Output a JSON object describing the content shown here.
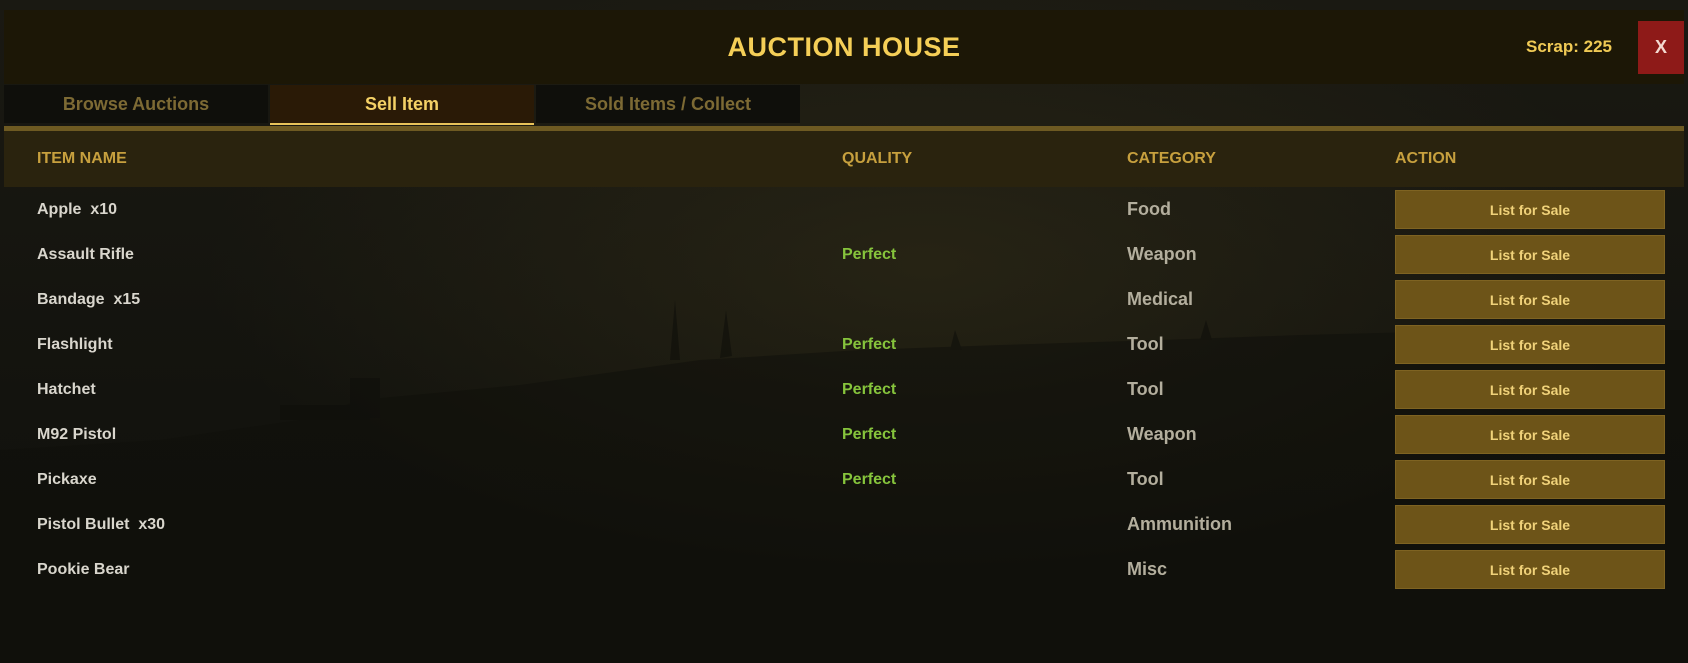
{
  "header": {
    "title": "AUCTION HOUSE",
    "scrap_label": "Scrap: 225",
    "close_label": "X"
  },
  "tabs": [
    {
      "label": "Browse Auctions",
      "active": false
    },
    {
      "label": "Sell Item",
      "active": true
    },
    {
      "label": "Sold Items / Collect",
      "active": false
    }
  ],
  "table": {
    "columns": [
      "ITEM NAME",
      "QUALITY",
      "CATEGORY",
      "ACTION"
    ],
    "rows": [
      {
        "name": "Apple  x10",
        "quality": "",
        "category": "Food",
        "action": "List for Sale"
      },
      {
        "name": "Assault Rifle",
        "quality": "Perfect",
        "category": "Weapon",
        "action": "List for Sale"
      },
      {
        "name": "Bandage  x15",
        "quality": "",
        "category": "Medical",
        "action": "List for Sale"
      },
      {
        "name": "Flashlight",
        "quality": "Perfect",
        "category": "Tool",
        "action": "List for Sale"
      },
      {
        "name": "Hatchet",
        "quality": "Perfect",
        "category": "Tool",
        "action": "List for Sale"
      },
      {
        "name": "M92 Pistol",
        "quality": "Perfect",
        "category": "Weapon",
        "action": "List for Sale"
      },
      {
        "name": "Pickaxe",
        "quality": "Perfect",
        "category": "Tool",
        "action": "List for Sale"
      },
      {
        "name": "Pistol Bullet  x30",
        "quality": "",
        "category": "Ammunition",
        "action": "List for Sale"
      },
      {
        "name": "Pookie Bear",
        "quality": "",
        "category": "Misc",
        "action": "List for Sale"
      }
    ]
  },
  "colors": {
    "accent": "#f5cf57",
    "quality_perfect": "#86c43c",
    "close_button": "#8e1a18",
    "action_button": "#6d5418"
  }
}
